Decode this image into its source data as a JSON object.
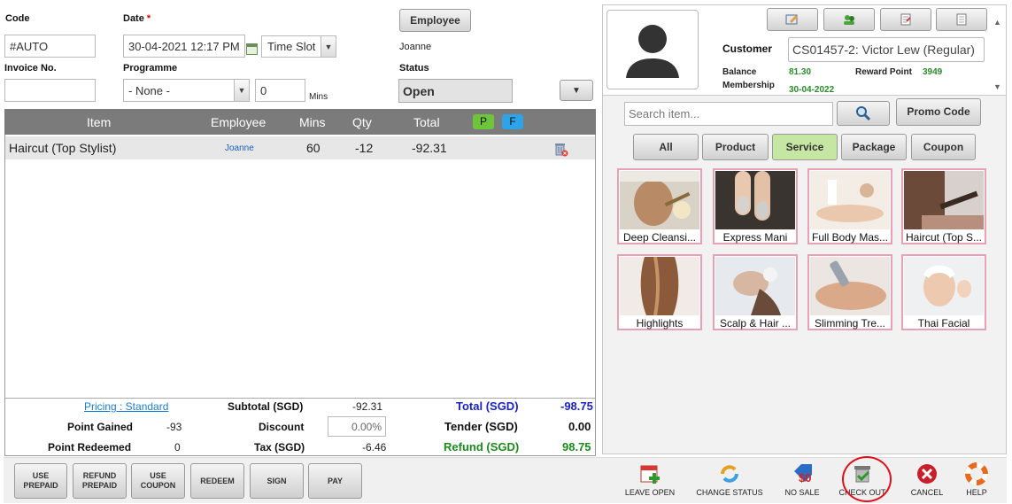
{
  "form": {
    "code_label": "Code",
    "code_value": "#AUTO",
    "date_label": "Date",
    "date_required": "*",
    "date_value": "30-04-2021 12:17 PM",
    "timeslot_value": "Time Slot",
    "employee_button": "Employee",
    "employee_name": "Joanne",
    "invoice_label": "Invoice No.",
    "invoice_value": "",
    "programme_label": "Programme",
    "programme_value": "- None -",
    "mins_value": "0",
    "mins_unit": "Mins",
    "status_label": "Status",
    "status_value": "Open"
  },
  "grid": {
    "headers": {
      "item": "Item",
      "employee": "Employee",
      "mins": "Mins",
      "qty": "Qty",
      "total": "Total",
      "p": "P",
      "f": "F"
    },
    "rows": [
      {
        "item": "Haircut (Top Stylist)",
        "employee": "Joanne",
        "mins": "60",
        "qty": "-12",
        "total": "-92.31",
        "delete_icon": "trash-delete-icon"
      }
    ]
  },
  "summary": {
    "pricing_link": "Pricing : Standard",
    "point_gained_label": "Point Gained",
    "point_gained_value": "-93",
    "point_redeemed_label": "Point Redeemed",
    "point_redeemed_value": "0",
    "subtotal_label": "Subtotal (SGD)",
    "subtotal_value": "-92.31",
    "discount_label": "Discount",
    "discount_value": "0.00%",
    "tax_label": "Tax (SGD)",
    "tax_value": "-6.46",
    "total_label": "Total (SGD)",
    "total_value": "-98.75",
    "tender_label": "Tender (SGD)",
    "tender_value": "0.00",
    "refund_label": "Refund (SGD)",
    "refund_value": "98.75"
  },
  "customer": {
    "customer_label": "Customer",
    "customer_value": "CS01457-2: Victor Lew (Regular)",
    "balance_label": "Balance",
    "balance_value": "81.30",
    "reward_label": "Reward Point",
    "reward_value": "3949",
    "membership_label": "Membership",
    "membership_value": "30-04-2022"
  },
  "catalog": {
    "search_placeholder": "Search item...",
    "promo_button": "Promo Code",
    "categories": [
      "All",
      "Product",
      "Service",
      "Package",
      "Coupon"
    ],
    "active_category": "Service",
    "items": [
      "Deep Cleansi...",
      "Express Mani",
      "Full Body Mas...",
      "Haircut (Top S...",
      "Highlights",
      "Scalp & Hair ...",
      "Slimming Tre...",
      "Thai Facial"
    ]
  },
  "actions": {
    "use_prepaid": "USE PREPAID",
    "refund_prepaid": "REFUND PREPAID",
    "use_coupon": "USE COUPON",
    "redeem": "REDEEM",
    "sign": "SIGN",
    "pay": "PAY",
    "leave_open": "LEAVE OPEN",
    "change_status": "CHANGE STATUS",
    "no_sale": "NO SALE",
    "check_out": "CHECK OUT",
    "cancel": "CANCEL",
    "help": "HELP"
  },
  "colors": {
    "active_category": "#c6e7a4",
    "total_blue": "#1a22c7",
    "refund_green": "#1c8a1c",
    "tile_border": "#e8a0b4",
    "highlight_circle": "#e0101a",
    "p_badge": "#6fc53a",
    "f_badge": "#2ea3e8"
  }
}
